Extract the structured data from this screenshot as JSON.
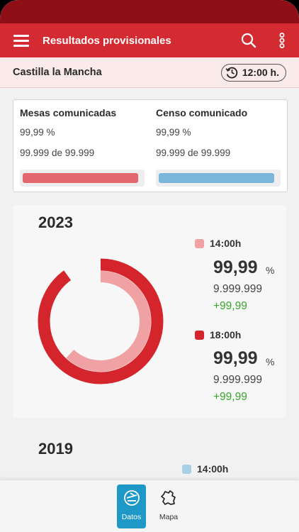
{
  "header": {
    "title": "Resultados provisionales",
    "menu_icon": "hamburger-menu-icon",
    "search_icon": "search-icon",
    "more_icon": "more-vertical-icon",
    "color": "#d42a31"
  },
  "region": {
    "name": "Castilla la Mancha",
    "time_label": "12:00 h.",
    "time_icon": "history-clock-icon"
  },
  "summary": {
    "mesas": {
      "title": "Mesas comunicadas",
      "percent": "99,99 %",
      "count": "99.999 de 99.999",
      "progress": 0.97,
      "color": "#e2686e"
    },
    "censo": {
      "title": "Censo comunicado",
      "percent": "99,99 %",
      "count": "99.999 de 99.999",
      "progress": 0.97,
      "color": "#7ab6da"
    }
  },
  "years": [
    {
      "year": "2023",
      "entries": [
        {
          "time": "14:00h",
          "value": "99,99",
          "unit": "%",
          "votes": "9.999.999",
          "diff": "+99,99",
          "color": "#f0a1a4",
          "ring_fraction": 0.62
        },
        {
          "time": "18:00h",
          "value": "99,99",
          "unit": "%",
          "votes": "9.999.999",
          "diff": "+99,99",
          "color": "#d4242c",
          "ring_fraction": 0.9
        }
      ]
    },
    {
      "year": "2019",
      "entries": [
        {
          "time": "14:00h",
          "color": "#a9cfe6"
        }
      ]
    }
  ],
  "bottom_nav": {
    "items": [
      {
        "label": "Datos",
        "icon": "ballot-box-icon",
        "active": true
      },
      {
        "label": "Mapa",
        "icon": "region-map-icon",
        "active": false
      }
    ]
  }
}
